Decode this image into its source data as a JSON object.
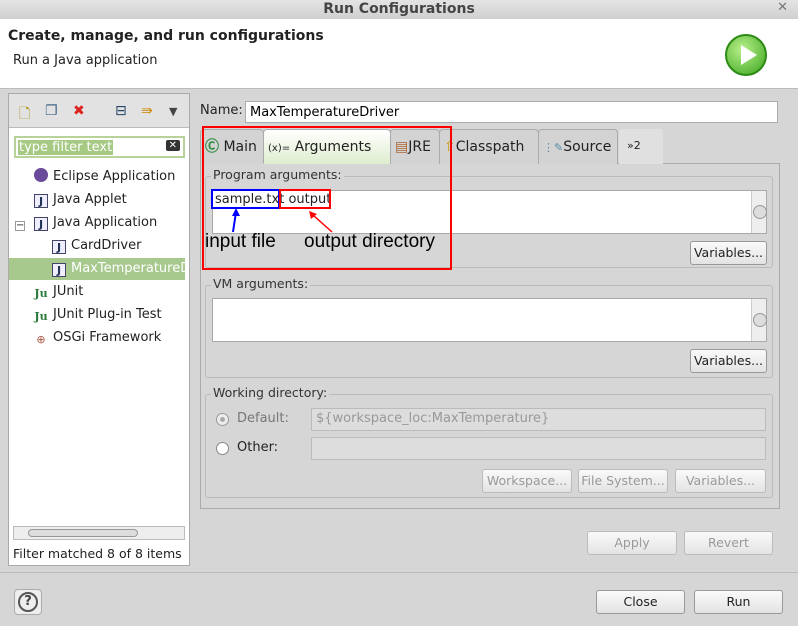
{
  "window": {
    "title": "Run Configurations",
    "close": "✕"
  },
  "header": {
    "title": "Create, manage, and run configurations",
    "subtitle": "Run a Java application"
  },
  "left": {
    "filter_placeholder": "type filter text",
    "tree": [
      {
        "label": "Eclipse Application",
        "icon": "eclipse-icon"
      },
      {
        "label": "Java Applet",
        "icon": "applet-icon"
      },
      {
        "label": "Java Application",
        "icon": "java-app-icon",
        "expanded": true
      },
      {
        "label": "CardDriver",
        "icon": "java-app-icon"
      },
      {
        "label": "MaxTemperatureDriver",
        "icon": "java-app-icon",
        "selected": true
      },
      {
        "label": "JUnit",
        "icon": "junit-icon"
      },
      {
        "label": "JUnit Plug-in Test",
        "icon": "junit-plugin-icon"
      },
      {
        "label": "OSGi Framework",
        "icon": "osgi-icon"
      }
    ],
    "status": "Filter matched 8 of 8 items"
  },
  "name_label": "Name:",
  "name_value": "MaxTemperatureDriver",
  "tabs": [
    "Main",
    "Arguments",
    "JRE",
    "Classpath",
    "Source",
    "»2"
  ],
  "active_tab": "Arguments",
  "program_args": {
    "label": "Program arguments:",
    "value": "sample.txt output",
    "arg1": "sample.txt",
    "arg2": "output",
    "variables": "Variables..."
  },
  "vm_args": {
    "label": "VM arguments:",
    "value": "",
    "variables": "Variables..."
  },
  "working_dir": {
    "label": "Working directory:",
    "default_label": "Default:",
    "default_value": "${workspace_loc:MaxTemperature}",
    "other_label": "Other:",
    "other_value": "",
    "workspace": "Workspace...",
    "filesystem": "File System...",
    "variables": "Variables..."
  },
  "buttons": {
    "apply": "Apply",
    "revert": "Revert",
    "close": "Close",
    "run": "Run",
    "help": "?"
  },
  "annotations": {
    "input": "input file",
    "output": "output directory"
  }
}
